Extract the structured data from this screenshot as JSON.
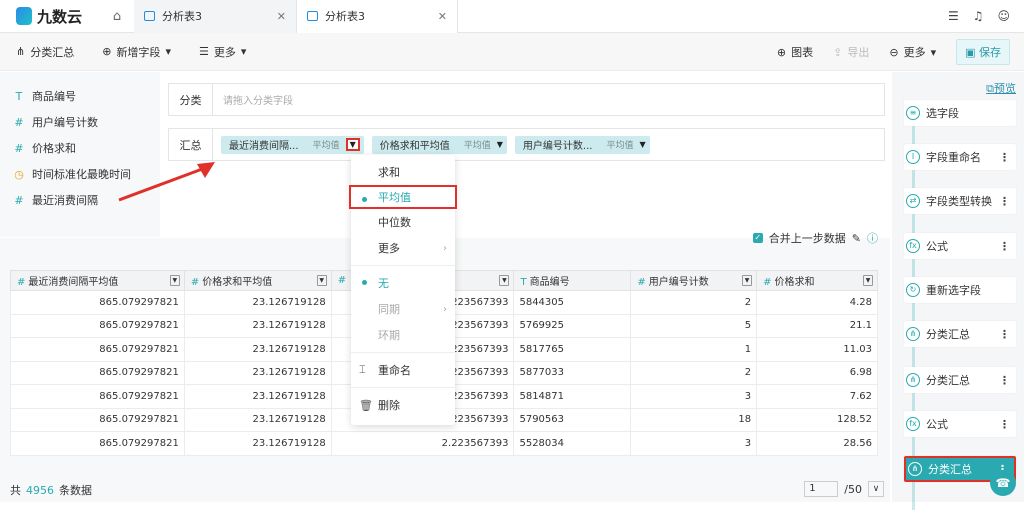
{
  "app": {
    "logo": "九数云"
  },
  "tabs": [
    {
      "label": "分析表3"
    },
    {
      "label": "分析表3"
    }
  ],
  "toolbar": {
    "classify": "分类汇总",
    "add_field": "新增字段",
    "more": "更多",
    "chart": "图表",
    "export": "导出",
    "more2": "更多",
    "save": "保存"
  },
  "fields": [
    {
      "icon": "T",
      "label": "商品编号"
    },
    {
      "icon": "#",
      "label": "用户编号计数"
    },
    {
      "icon": "#",
      "label": "价格求和"
    },
    {
      "icon": "◷",
      "label": "时间标准化最晚时间"
    },
    {
      "icon": "#",
      "label": "最近消费间隔"
    }
  ],
  "zones": {
    "classify_label": "分类",
    "classify_placeholder": "请拖入分类字段",
    "summary_label": "汇总"
  },
  "chips": [
    {
      "label": "最近消费间隔...",
      "agg": "平均值"
    },
    {
      "label": "价格求和平均值",
      "agg": "平均值"
    },
    {
      "label": "用户编号计数...",
      "agg": "平均值"
    }
  ],
  "merge_label": "合并上一步数据",
  "table": {
    "headers": [
      "最近消费间隔平均值",
      "价格求和平均值",
      "",
      "商品编号",
      "用户编号计数",
      "价格求和"
    ],
    "rows": [
      [
        "865.079297821",
        "23.126719128",
        "2.223567393",
        "5844305",
        "2",
        "4.28"
      ],
      [
        "865.079297821",
        "23.126719128",
        "2.223567393",
        "5769925",
        "5",
        "21.1"
      ],
      [
        "865.079297821",
        "23.126719128",
        "2.223567393",
        "5817765",
        "1",
        "11.03"
      ],
      [
        "865.079297821",
        "23.126719128",
        "2.223567393",
        "5877033",
        "2",
        "6.98"
      ],
      [
        "865.079297821",
        "23.126719128",
        "2.223567393",
        "5814871",
        "3",
        "7.62"
      ],
      [
        "865.079297821",
        "23.126719128",
        "2.223567393",
        "5790563",
        "18",
        "128.52"
      ],
      [
        "865.079297821",
        "23.126719128",
        "2.223567393",
        "5528034",
        "3",
        "28.56"
      ]
    ]
  },
  "footer": {
    "prefix": "共",
    "count": "4956",
    "suffix": "条数据",
    "page": "1",
    "total": "/50"
  },
  "menu": {
    "sum": "求和",
    "avg": "平均值",
    "median": "中位数",
    "more": "更多",
    "none": "无",
    "yoy": "同期",
    "mom": "环期",
    "rename": "重命名",
    "delete": "删除"
  },
  "steps": [
    {
      "label": "选字段",
      "icon": "≡"
    },
    {
      "label": "字段重命名",
      "icon": "I"
    },
    {
      "label": "字段类型转换",
      "icon": "⇄"
    },
    {
      "label": "公式",
      "icon": "fx"
    },
    {
      "label": "重新选字段",
      "icon": "↻"
    },
    {
      "label": "分类汇总",
      "icon": "⋔"
    },
    {
      "label": "分类汇总",
      "icon": "⋔"
    },
    {
      "label": "公式",
      "icon": "fx"
    },
    {
      "label": "分类汇总",
      "icon": "⋔"
    }
  ],
  "preview": "预览"
}
